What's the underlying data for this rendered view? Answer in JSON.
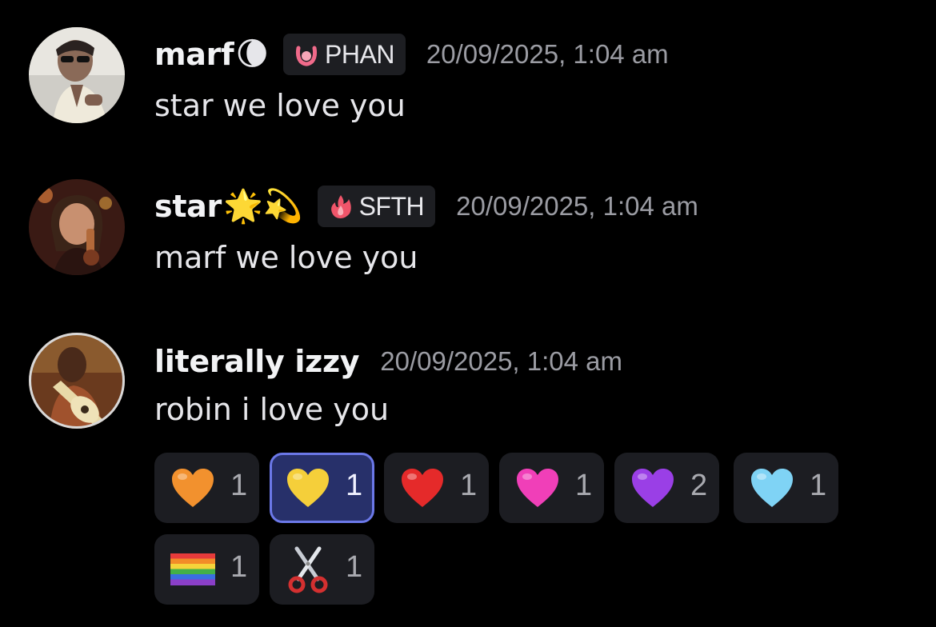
{
  "messages": [
    {
      "username": "marf",
      "name_emoji": "🌘",
      "tag": {
        "icon": "ring-icon",
        "label": "PHAN",
        "icon_color": "#f06a8a"
      },
      "timestamp": "20/09/2025, 1:04 am",
      "content": "star we love you"
    },
    {
      "username": "star",
      "name_emoji": "🌟💫",
      "tag": {
        "icon": "fire-icon",
        "label": "SFTH",
        "icon_color": "#f0556a"
      },
      "timestamp": "20/09/2025, 1:04 am",
      "content": "marf we love you"
    },
    {
      "username": "literally izzy",
      "name_emoji": "",
      "timestamp": "20/09/2025, 1:04 am",
      "content": "robin i love you",
      "reactions": [
        {
          "icon": "orange-heart-icon",
          "color": "#f2912e",
          "count": "1",
          "active": false
        },
        {
          "icon": "yellow-heart-icon",
          "color": "#f5cf3a",
          "count": "1",
          "active": true
        },
        {
          "icon": "red-heart-icon",
          "color": "#e52a2a",
          "count": "1",
          "active": false
        },
        {
          "icon": "pink-heart-icon",
          "color": "#f03fb8",
          "count": "1",
          "active": false
        },
        {
          "icon": "purple-heart-icon",
          "color": "#9a3fe6",
          "count": "2",
          "active": false
        },
        {
          "icon": "light-blue-heart-icon",
          "color": "#7fd3f5",
          "count": "1",
          "active": false
        },
        {
          "icon": "rainbow-flag-icon",
          "count": "1",
          "active": false
        },
        {
          "icon": "scissors-icon",
          "count": "1",
          "active": false
        }
      ]
    }
  ],
  "colors": {
    "background": "#000000",
    "reaction_bg": "#1c1d22",
    "reaction_active_bg": "#27306a",
    "reaction_active_border": "#6b78e8",
    "timestamp": "#9b9ca3"
  }
}
